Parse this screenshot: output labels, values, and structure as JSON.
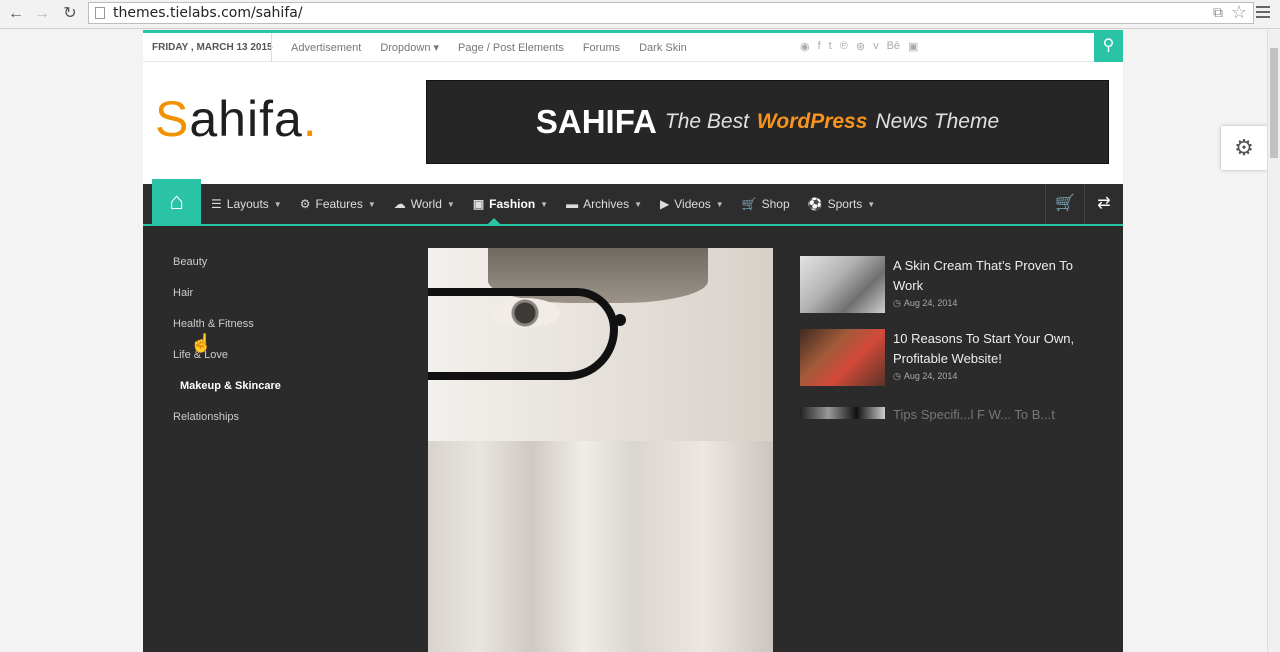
{
  "browser": {
    "url": "themes.tielabs.com/sahifa/",
    "back_icon": "←",
    "forward_icon": "→",
    "reload_icon": "↻",
    "star_icon": "☆",
    "translate_icon": "⧉"
  },
  "topbar": {
    "date": "FRIDAY , MARCH 13 2015",
    "links": [
      "Advertisement",
      "Dropdown",
      "Page / Post Elements",
      "Forums",
      "Dark Skin"
    ],
    "social_icons": [
      "rss",
      "facebook",
      "twitter",
      "pinterest",
      "dribbble",
      "vimeo",
      "behance",
      "instagram"
    ],
    "accent": "#2bc3a6"
  },
  "logo": {
    "s": "S",
    "rest": "ahifa",
    "dot": "."
  },
  "banner": {
    "brand": "SAHIFA",
    "tagline_1": "The Best",
    "tagline_2": "WordPress",
    "tagline_3": "News Theme"
  },
  "nav": {
    "items": [
      {
        "label": "Layouts"
      },
      {
        "label": "Features"
      },
      {
        "label": "World"
      },
      {
        "label": "Fashion"
      },
      {
        "label": "Archives"
      },
      {
        "label": "Videos"
      },
      {
        "label": "Shop"
      },
      {
        "label": "Sports"
      }
    ],
    "active": "Fashion"
  },
  "submenu": [
    "Beauty",
    "Hair",
    "Health & Fitness",
    "Life & Love",
    "Makeup & Skincare",
    "Relationships"
  ],
  "posts": [
    {
      "title": "A Skin Cream That’s Proven To Work",
      "date": "Aug 24, 2014"
    },
    {
      "title": "10 Reasons To Start Your Own, Profitable Website!",
      "date": "Aug 24, 2014"
    },
    {
      "title": "Tips Specifi...l F W... To B...t"
    }
  ]
}
